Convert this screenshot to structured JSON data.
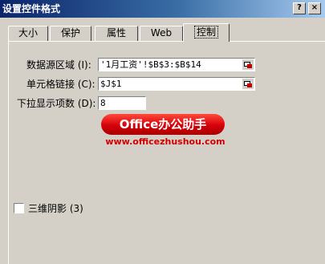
{
  "window": {
    "title": "设置控件格式"
  },
  "tabs": [
    {
      "label": "大小"
    },
    {
      "label": "保护"
    },
    {
      "label": "属性"
    },
    {
      "label": "Web"
    },
    {
      "label": "控制"
    }
  ],
  "control": {
    "source_range_label": "数据源区域 (I):",
    "source_range_value": "'1月工资'!$B$3:$B$14",
    "cell_link_label": "单元格链接 (C):",
    "cell_link_value": "$J$1",
    "dropdown_lines_label": "下拉显示项数 (D):",
    "dropdown_lines_value": "8",
    "shading_label": "三维阴影 (3)",
    "shading_checked": false
  },
  "watermark": {
    "brand": "Office办公助手",
    "url": "www.officezhushou.com"
  },
  "icons": [
    "cell-reference-picker-icon"
  ],
  "colors": {
    "title_start": "#0a246a",
    "title_end": "#a6caf0",
    "face": "#d4d0c8",
    "brand_red": "#d5000a"
  }
}
